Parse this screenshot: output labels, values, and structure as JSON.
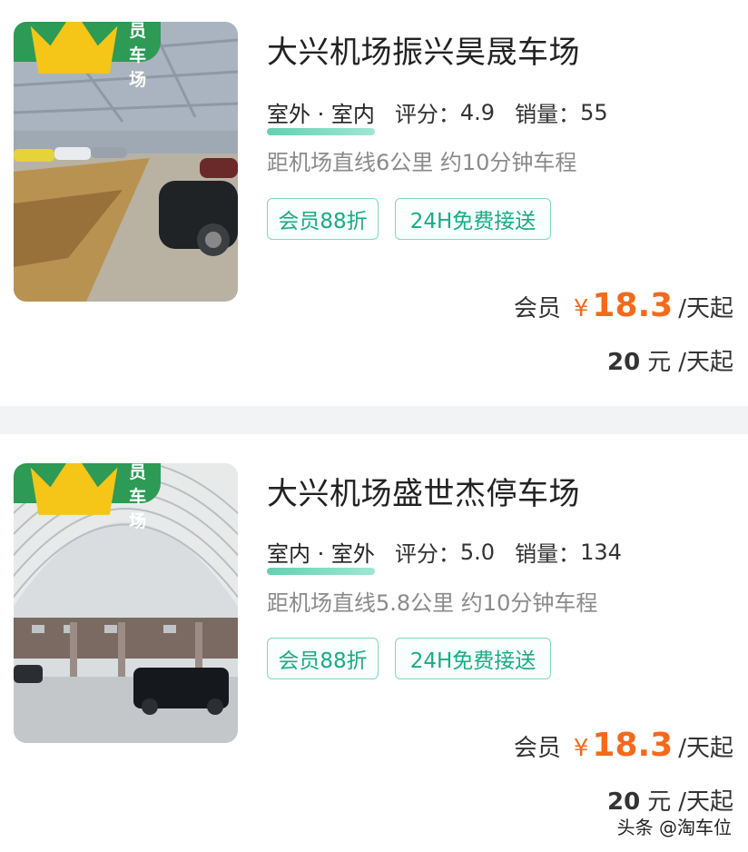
{
  "listings": [
    {
      "badge": "会员车场",
      "title": "大兴机场振兴昊晟车场",
      "type": "室外 · 室内",
      "rating_label": "评分：",
      "rating": "4.9",
      "sales_label": "销量：",
      "sales": "55",
      "distance": "距机场直线6公里 约10分钟车程",
      "chips": [
        "会员88折",
        "24H免费接送"
      ],
      "member_price_label": "会员",
      "currency": "¥",
      "member_price": "18.3",
      "per_day": "/天起",
      "normal_price": "20",
      "normal_unit": "元",
      "normal_per_day": "/天起"
    },
    {
      "badge": "会员车场",
      "title": "大兴机场盛世杰停车场",
      "type": "室内 · 室外",
      "rating_label": "评分：",
      "rating": "5.0",
      "sales_label": "销量：",
      "sales": "134",
      "distance": "距机场直线5.8公里 约10分钟车程",
      "chips": [
        "会员88折",
        "24H免费接送"
      ],
      "member_price_label": "会员",
      "currency": "¥",
      "member_price": "18.3",
      "per_day": "/天起",
      "normal_price": "20",
      "normal_unit": "元",
      "normal_per_day": "/天起"
    }
  ],
  "watermark": "头条 @淘车位",
  "icons": {
    "badge": "crown-icon"
  },
  "colors": {
    "accent_green": "#2d9a55",
    "chip_green": "#1aaa86",
    "price_orange": "#f26a1b"
  }
}
